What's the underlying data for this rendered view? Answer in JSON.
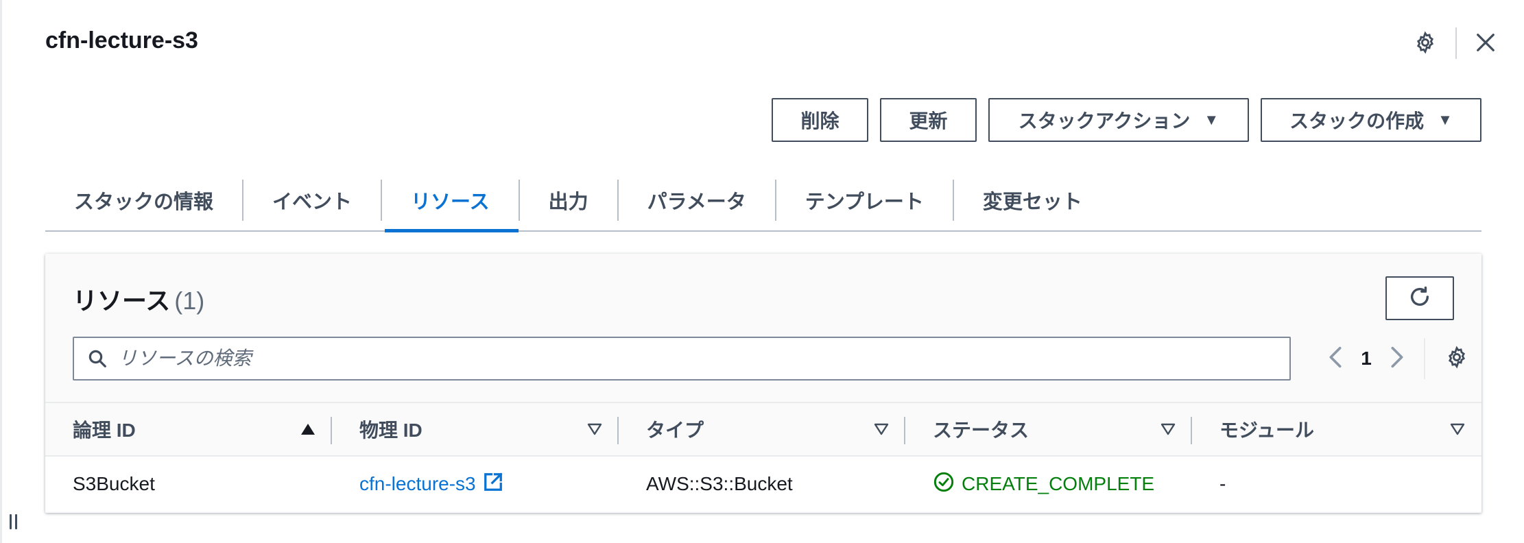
{
  "header": {
    "title": "cfn-lecture-s3"
  },
  "actions": {
    "delete_label": "削除",
    "update_label": "更新",
    "stack_actions_label": "スタックアクション",
    "create_stack_label": "スタックの作成"
  },
  "tabs": [
    {
      "label": "スタックの情報",
      "active": false
    },
    {
      "label": "イベント",
      "active": false
    },
    {
      "label": "リソース",
      "active": true
    },
    {
      "label": "出力",
      "active": false
    },
    {
      "label": "パラメータ",
      "active": false
    },
    {
      "label": "テンプレート",
      "active": false
    },
    {
      "label": "変更セット",
      "active": false
    }
  ],
  "resources": {
    "title": "リソース",
    "count": "(1)",
    "search_placeholder": "リソースの検索",
    "search_value": "",
    "page_number": "1",
    "columns": [
      "論理 ID",
      "物理 ID",
      "タイプ",
      "ステータス",
      "モジュール"
    ],
    "rows": [
      {
        "logical_id": "S3Bucket",
        "physical_id": "cfn-lecture-s3",
        "type": "AWS::S3::Bucket",
        "status": "CREATE_COMPLETE",
        "module": "-"
      }
    ]
  },
  "icons": {
    "settings": "gear-icon",
    "close": "close-icon",
    "refresh": "refresh-icon",
    "search": "search-icon",
    "external_link": "external-link-icon",
    "status_success": "check-circle-icon"
  },
  "colors": {
    "link": "#0972d3",
    "success": "#037f0c",
    "text": "#16191f",
    "button_border": "#414d5c"
  }
}
